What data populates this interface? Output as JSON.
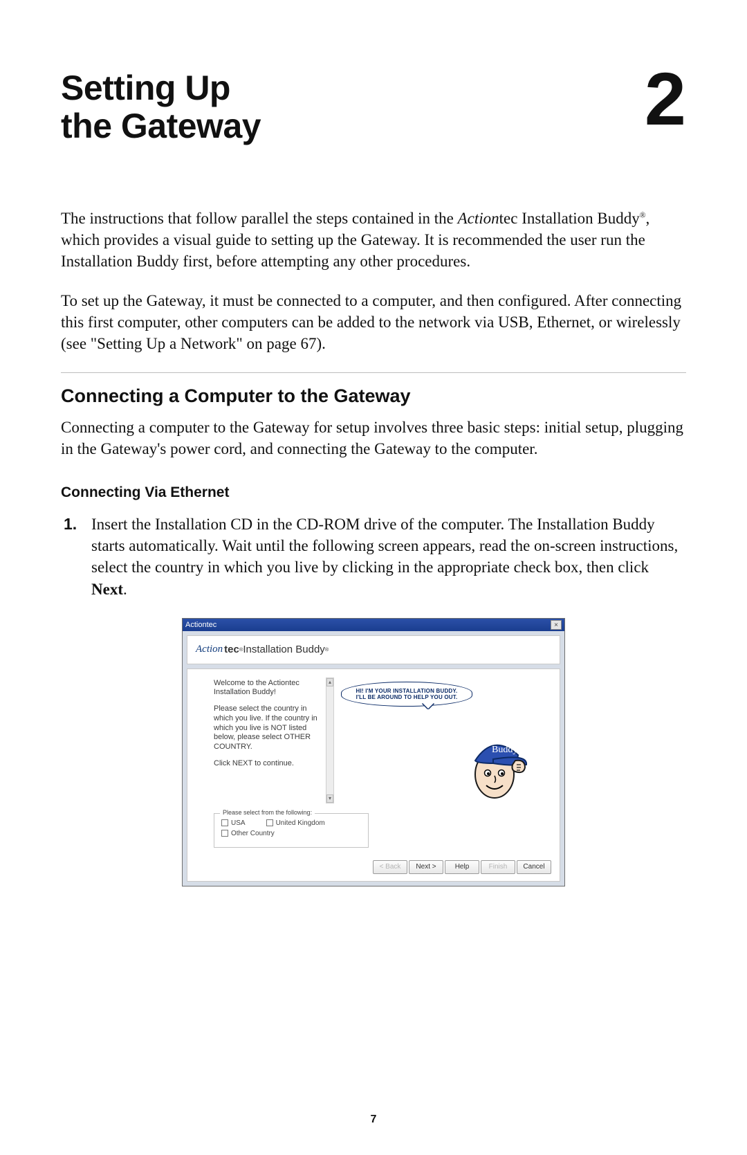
{
  "chapter": {
    "title_line1": "Setting Up",
    "title_line2": "the Gateway",
    "number": "2"
  },
  "paragraphs": {
    "p1_a": "The instructions that follow parallel the steps contained in the ",
    "p1_brand_italic": "Action",
    "p1_brand_rest": "tec",
    "p1_b": " Installation Buddy",
    "p1_reg": "®",
    "p1_c": ", which provides a visual guide to setting up the Gateway. It is recommended the user run the Installation Buddy first, before attempting any other procedures.",
    "p2_a": "To set up the Gateway, it must be connected to a computer, and then configured. After connecting this first computer, other computers can be added to the network via ",
    "p2_usb": "USB",
    "p2_b": ", Ethernet, or wirelessly (see \"Setting Up a Network\" on page 67)."
  },
  "section_h2": "Connecting a Computer to the Gateway",
  "section_p": "Connecting a computer to the Gateway for setup involves three basic steps: initial setup, plugging in the Gateway's power cord, and connecting the Gateway to the computer.",
  "subsection_h3": "Connecting Via Ethernet",
  "step1": {
    "num": "1.",
    "a": "Insert the Installation ",
    "cd": "CD",
    "b": " in the ",
    "cdrom": "CD-ROM",
    "c": " drive of the computer. The Installation Buddy starts automatically. Wait until the following screen appears, read the on-screen instructions, select the country in which you live by clicking in the appropriate check box, then click ",
    "next": "Next",
    "d": "."
  },
  "screenshot": {
    "titlebar_label": "Actiontec",
    "close_glyph": "×",
    "brand_logo": "Action",
    "brand_rest": "tec",
    "brand_reg": "®",
    "brand_suffix": " Installation Buddy",
    "brand_reg2": "®",
    "welcome": "Welcome to the Actiontec Installation Buddy!",
    "instructions": "Please select the country in which you live.  If the country in which you live is NOT listed below, please select OTHER COUNTRY.",
    "continue": "Click NEXT to continue.",
    "speech_line1": "HI! I'M YOUR INSTALLATION BUDDY.",
    "speech_line2": "I'LL BE AROUND TO HELP YOU OUT.",
    "cap_text": "Buddy",
    "legend": "Please select from the following:",
    "opt_usa": "USA",
    "opt_uk": "United Kingdom",
    "opt_other": "Other Country",
    "scroll_up": "▴",
    "scroll_down": "▾",
    "buttons": {
      "back": "< Back",
      "next": "Next >",
      "help": "Help",
      "finish": "Finish",
      "cancel": "Cancel"
    }
  },
  "page_number": "7"
}
